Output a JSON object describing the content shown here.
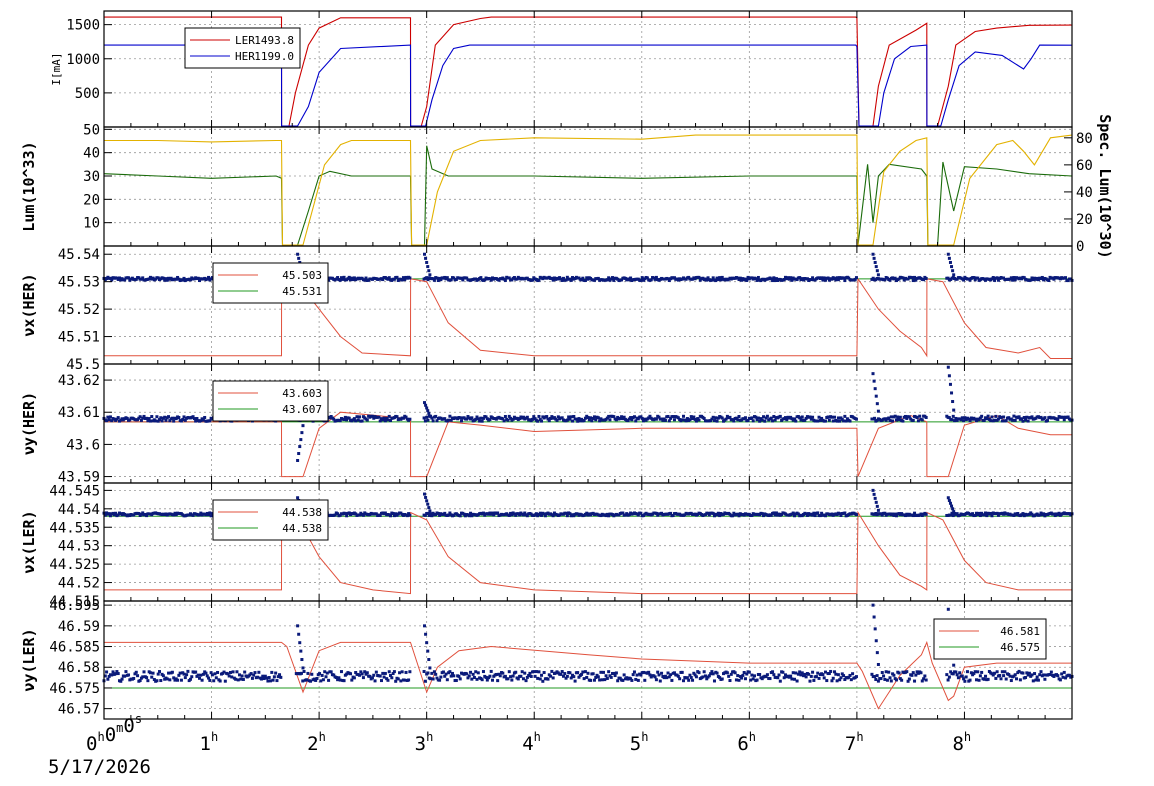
{
  "figure": {
    "time_origin_label": "0h0m0s",
    "date_label": "5/17/2026",
    "x_tick_labels": [
      "1h",
      "2h",
      "3h",
      "4h",
      "5h",
      "6h",
      "7h",
      "8h"
    ]
  },
  "colors": {
    "ler": "#cc0000",
    "her": "#0000cc",
    "lum": "#1a6b0a",
    "spec_lum": "#e3b200",
    "tune_ref": "#e0503c",
    "tune_set": "#229922",
    "tune_meas": "#0a1a7a"
  },
  "chart_data": [
    {
      "id": "beam-current",
      "type": "line",
      "ylabel": "I[mA]",
      "ylim": [
        0,
        1700
      ],
      "yticks": [
        500,
        1000,
        1500
      ],
      "ytick_labels": [
        "500",
        "1000",
        "1500"
      ],
      "legend": {
        "placement": "top-left",
        "entries": [
          {
            "name": "LER",
            "value": "1493.8"
          },
          {
            "name": "HER",
            "value": "1199.0"
          }
        ]
      },
      "series": [
        {
          "name": "LER",
          "color_key": "ler",
          "x": [
            0,
            1.65,
            1.651,
            1.72,
            1.78,
            1.9,
            2.0,
            2.2,
            2.85,
            2.851,
            2.95,
            3.0,
            3.08,
            3.25,
            3.5,
            3.6,
            6.99,
            7.0,
            7.02,
            7.15,
            7.2,
            7.3,
            7.55,
            7.65,
            7.651,
            7.75,
            7.85,
            7.92,
            8.1,
            8.3,
            8.6,
            9.0
          ],
          "y": [
            1610,
            1610,
            0,
            0,
            500,
            1200,
            1450,
            1600,
            1600,
            0,
            0,
            300,
            1200,
            1500,
            1590,
            1610,
            1610,
            1600,
            0,
            0,
            600,
            1200,
            1420,
            1520,
            0,
            0,
            600,
            1200,
            1400,
            1450,
            1490,
            1494
          ]
        },
        {
          "name": "HER",
          "color_key": "her",
          "x": [
            0,
            1.65,
            1.651,
            1.8,
            1.9,
            2.0,
            2.2,
            2.85,
            2.851,
            2.99,
            3.05,
            3.15,
            3.25,
            3.4,
            6.99,
            7.0,
            7.02,
            7.2,
            7.25,
            7.35,
            7.5,
            7.65,
            7.651,
            7.78,
            7.85,
            7.95,
            8.1,
            8.35,
            8.5,
            8.55,
            8.62,
            8.7,
            9.0
          ],
          "y": [
            1200,
            1200,
            0,
            0,
            300,
            800,
            1150,
            1200,
            0,
            0,
            400,
            900,
            1150,
            1200,
            1200,
            1180,
            0,
            0,
            500,
            1000,
            1180,
            1200,
            0,
            0,
            400,
            900,
            1100,
            1050,
            900,
            850,
            1000,
            1200,
            1199
          ]
        }
      ]
    },
    {
      "id": "luminosity",
      "type": "line",
      "ylabel": "Lum(10^33)",
      "ylim": [
        0,
        51
      ],
      "yticks": [
        10,
        20,
        30,
        40,
        50
      ],
      "ytick_labels": [
        "10",
        "20",
        "30",
        "40",
        "50"
      ],
      "y2label": "Spec. Lum(10^30)",
      "y2lim": [
        0,
        88
      ],
      "y2ticks": [
        0,
        20,
        40,
        60,
        80
      ],
      "y2tick_labels": [
        "0",
        "20",
        "40",
        "60",
        "80"
      ],
      "series": [
        {
          "name": "Lum",
          "color_key": "lum",
          "x": [
            0,
            0.5,
            1.0,
            1.6,
            1.65,
            1.66,
            1.8,
            1.9,
            2.0,
            2.1,
            2.3,
            2.85,
            2.86,
            2.98,
            3.0,
            3.05,
            3.2,
            3.5,
            4.0,
            5.0,
            6.0,
            7.0,
            7.01,
            7.1,
            7.15,
            7.2,
            7.3,
            7.6,
            7.65,
            7.66,
            7.75,
            7.8,
            7.9,
            8.0,
            8.3,
            8.6,
            9.0
          ],
          "y": [
            31,
            30,
            29,
            30,
            29,
            0,
            0,
            15,
            30,
            32,
            30,
            30,
            0,
            0,
            43,
            33,
            30,
            30,
            30,
            29,
            30,
            30,
            0,
            35,
            10,
            30,
            35,
            33,
            30,
            0,
            0,
            36,
            15,
            34,
            33,
            31,
            30
          ]
        },
        {
          "name": "Spec. Lum",
          "color_key": "spec_lum",
          "axis": "right",
          "x": [
            0,
            0.5,
            1.0,
            1.6,
            1.65,
            1.66,
            1.85,
            1.95,
            2.05,
            2.2,
            2.3,
            2.85,
            2.86,
            3.0,
            3.1,
            3.25,
            3.5,
            4.0,
            5.0,
            5.5,
            6.0,
            7.0,
            7.01,
            7.15,
            7.25,
            7.4,
            7.55,
            7.65,
            7.66,
            7.9,
            8.05,
            8.3,
            8.45,
            8.55,
            8.65,
            8.8,
            9.0
          ],
          "y": [
            78,
            78,
            77,
            78,
            78,
            0,
            0,
            30,
            60,
            75,
            78,
            78,
            0,
            0,
            40,
            70,
            78,
            80,
            79,
            82,
            82,
            82,
            0,
            0,
            55,
            70,
            78,
            80,
            0,
            0,
            50,
            75,
            78,
            70,
            60,
            80,
            82
          ]
        }
      ]
    },
    {
      "id": "nux-her",
      "type": "scatter",
      "ylabel": "νx(HER)",
      "ylim": [
        45.5,
        45.543
      ],
      "yticks": [
        45.5,
        45.51,
        45.52,
        45.53,
        45.54
      ],
      "ytick_labels": [
        "45.5",
        "45.51",
        "45.52",
        "45.53",
        "45.54"
      ],
      "legend": {
        "placement": "top-left",
        "entries": [
          {
            "name": "",
            "value": "45.503"
          },
          {
            "name": "",
            "value": "45.531"
          }
        ]
      },
      "reference_line": {
        "color_key": "tune_ref",
        "x": [
          0,
          1.65,
          1.651,
          1.8,
          2.0,
          2.2,
          2.4,
          2.85,
          2.851,
          3.0,
          3.2,
          3.5,
          4.0,
          5.0,
          7.0,
          7.01,
          7.2,
          7.4,
          7.6,
          7.65,
          7.651,
          7.8,
          8.0,
          8.2,
          8.5,
          8.7,
          8.8,
          9.0
        ],
        "y": [
          45.503,
          45.503,
          45.531,
          45.53,
          45.52,
          45.51,
          45.504,
          45.503,
          45.531,
          45.53,
          45.515,
          45.505,
          45.503,
          45.503,
          45.503,
          45.531,
          45.52,
          45.512,
          45.506,
          45.503,
          45.531,
          45.53,
          45.515,
          45.506,
          45.504,
          45.506,
          45.502,
          45.502
        ]
      },
      "set_line": {
        "color_key": "tune_set",
        "value": 45.531
      },
      "measured": {
        "color_key": "tune_meas",
        "value": 45.531,
        "spread": 0.0006,
        "spikes": [
          {
            "x": 1.8,
            "y": 45.54
          },
          {
            "x": 2.98,
            "y": 45.54
          },
          {
            "x": 7.15,
            "y": 45.54
          },
          {
            "x": 7.85,
            "y": 45.54
          }
        ]
      }
    },
    {
      "id": "nuy-her",
      "type": "scatter",
      "ylabel": "νy(HER)",
      "ylim": [
        43.588,
        43.625
      ],
      "yticks": [
        43.59,
        43.6,
        43.61,
        43.62
      ],
      "ytick_labels": [
        "43.59",
        "43.6",
        "43.61",
        "43.62"
      ],
      "legend": {
        "placement": "top-left",
        "entries": [
          {
            "name": "",
            "value": "43.603"
          },
          {
            "name": "",
            "value": "43.607"
          }
        ]
      },
      "reference_line": {
        "color_key": "tune_ref",
        "x": [
          0,
          1.65,
          1.651,
          1.85,
          2.0,
          2.2,
          2.85,
          2.851,
          3.0,
          3.2,
          3.5,
          4.0,
          5.0,
          7.0,
          7.01,
          7.2,
          7.5,
          7.65,
          7.651,
          7.85,
          8.0,
          8.3,
          8.5,
          8.8,
          9.0
        ],
        "y": [
          43.607,
          43.607,
          43.59,
          43.59,
          43.605,
          43.61,
          43.608,
          43.59,
          43.59,
          43.607,
          43.606,
          43.604,
          43.605,
          43.605,
          43.59,
          43.605,
          43.609,
          43.607,
          43.59,
          43.59,
          43.606,
          43.609,
          43.605,
          43.603,
          43.603
        ]
      },
      "set_line": {
        "color_key": "tune_set",
        "value": 43.607
      },
      "measured": {
        "color_key": "tune_meas",
        "value": 43.608,
        "spread": 0.0008,
        "spikes": [
          {
            "x": 1.8,
            "y": 43.595
          },
          {
            "x": 2.98,
            "y": 43.613
          },
          {
            "x": 7.15,
            "y": 43.622
          },
          {
            "x": 7.85,
            "y": 43.624
          }
        ]
      }
    },
    {
      "id": "nux-ler",
      "type": "scatter",
      "ylabel": "νx(LER)",
      "ylim": [
        44.515,
        44.547
      ],
      "yticks": [
        44.515,
        44.52,
        44.525,
        44.53,
        44.535,
        44.54,
        44.545
      ],
      "ytick_labels": [
        "44.515",
        "44.52",
        "44.525",
        "44.53",
        "44.535",
        "44.54",
        "44.545"
      ],
      "legend": {
        "placement": "top-left",
        "entries": [
          {
            "name": "",
            "value": "44.538"
          },
          {
            "name": "",
            "value": "44.538"
          }
        ]
      },
      "reference_line": {
        "color_key": "tune_ref",
        "x": [
          0,
          1.65,
          1.651,
          1.85,
          2.0,
          2.2,
          2.5,
          2.85,
          2.851,
          3.0,
          3.2,
          3.5,
          4.0,
          5.0,
          7.0,
          7.01,
          7.2,
          7.4,
          7.6,
          7.65,
          7.651,
          7.8,
          8.0,
          8.2,
          8.5,
          9.0
        ],
        "y": [
          44.518,
          44.518,
          44.539,
          44.535,
          44.527,
          44.52,
          44.518,
          44.517,
          44.539,
          44.537,
          44.527,
          44.52,
          44.518,
          44.517,
          44.517,
          44.539,
          44.53,
          44.522,
          44.519,
          44.518,
          44.539,
          44.537,
          44.526,
          44.52,
          44.518,
          44.518
        ]
      },
      "set_line": {
        "color_key": "tune_set",
        "value": 44.538
      },
      "measured": {
        "color_key": "tune_meas",
        "value": 44.5385,
        "spread": 0.0004,
        "spikes": [
          {
            "x": 1.8,
            "y": 44.543
          },
          {
            "x": 2.98,
            "y": 44.544
          },
          {
            "x": 7.15,
            "y": 44.545
          },
          {
            "x": 7.85,
            "y": 44.543
          }
        ]
      }
    },
    {
      "id": "nuy-ler",
      "type": "scatter",
      "ylabel": "νy(LER)",
      "ylim": [
        46.5675,
        46.596
      ],
      "yticks": [
        46.57,
        46.575,
        46.58,
        46.585,
        46.59,
        46.595
      ],
      "ytick_labels": [
        "46.57",
        "46.575",
        "46.58",
        "46.585",
        "46.59",
        "46.595"
      ],
      "legend": {
        "placement": "top-right",
        "entries": [
          {
            "name": "",
            "value": "46.581"
          },
          {
            "name": "",
            "value": "46.575"
          }
        ]
      },
      "reference_line": {
        "color_key": "tune_ref",
        "x": [
          0,
          1.65,
          1.7,
          1.85,
          2.0,
          2.2,
          2.85,
          2.9,
          3.0,
          3.1,
          3.3,
          3.6,
          4.5,
          5.0,
          6.0,
          7.0,
          7.05,
          7.2,
          7.4,
          7.6,
          7.65,
          7.7,
          7.85,
          7.9,
          8.0,
          8.3,
          8.6,
          9.0
        ],
        "y": [
          46.586,
          46.586,
          46.585,
          46.574,
          46.584,
          46.586,
          46.586,
          46.582,
          46.574,
          46.58,
          46.584,
          46.585,
          46.583,
          46.582,
          46.581,
          46.581,
          46.579,
          46.57,
          46.578,
          46.583,
          46.586,
          46.581,
          46.572,
          46.573,
          46.58,
          46.581,
          46.581,
          46.581
        ]
      },
      "set_line": {
        "color_key": "tune_set",
        "value": 46.575
      },
      "measured": {
        "color_key": "tune_meas",
        "value": 46.5778,
        "spread": 0.0012,
        "spikes": [
          {
            "x": 1.8,
            "y": 46.59
          },
          {
            "x": 2.98,
            "y": 46.59
          },
          {
            "x": 7.15,
            "y": 46.595
          },
          {
            "x": 7.85,
            "y": 46.594
          }
        ]
      }
    }
  ]
}
